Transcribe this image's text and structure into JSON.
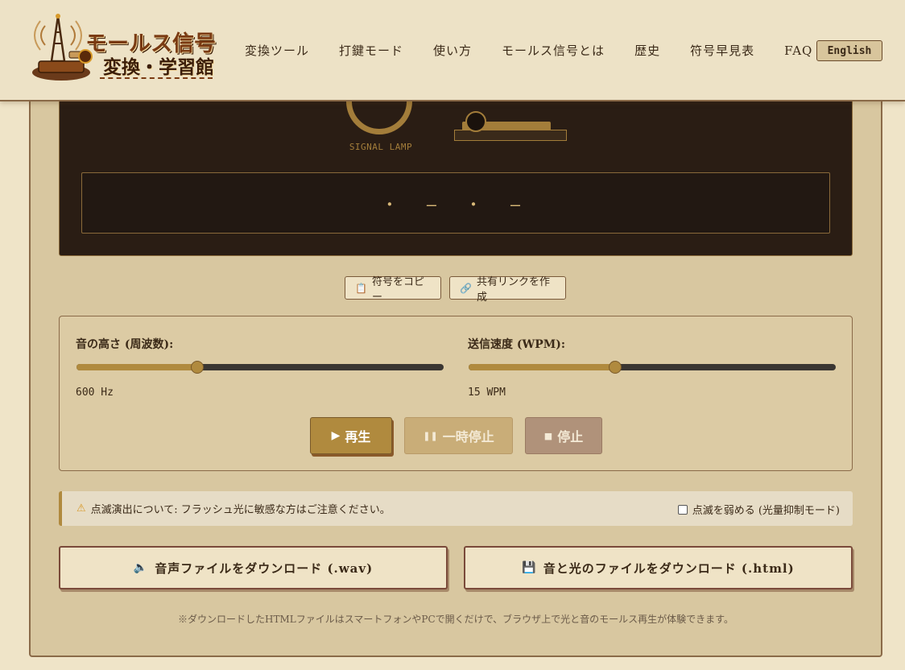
{
  "header": {
    "logo_line1": "モールス信号",
    "logo_line2": "変換・学習館",
    "nav": [
      "変換ツール",
      "打鍵モード",
      "使い方",
      "モールス信号とは",
      "歴史",
      "符号早見表",
      "FAQ"
    ],
    "lang_button": "English"
  },
  "display": {
    "lamp_label": "SIGNAL LAMP",
    "morse_output": "・ — ・ —"
  },
  "actions": {
    "copy_label": "符号をコピー",
    "share_label": "共有リンクを作成"
  },
  "controls": {
    "frequency_label": "音の高さ (周波数):",
    "frequency_value": "600 Hz",
    "frequency_fraction": 0.33,
    "wpm_label": "送信速度 (WPM):",
    "wpm_value": "15 WPM",
    "wpm_fraction": 0.4,
    "play_label": "再生",
    "pause_label": "一時停止",
    "stop_label": "停止"
  },
  "warning": {
    "text": "点滅演出について: フラッシュ光に敏感な方はご注意ください。",
    "checkbox_label": "点滅を弱める (光量抑制モード)"
  },
  "downloads": {
    "wav_label": "音声ファイルをダウンロード (.wav)",
    "html_label": "音と光のファイルをダウンロード (.html)",
    "note": "※ダウンロードしたHTMLファイルはスマートフォンやPCで開くだけで、ブラウザ上で光と音のモールス再生が体験できます。"
  },
  "colors": {
    "accent": "#b08a3e",
    "background": "#efe4c8",
    "display_bg": "#2a1d14"
  }
}
